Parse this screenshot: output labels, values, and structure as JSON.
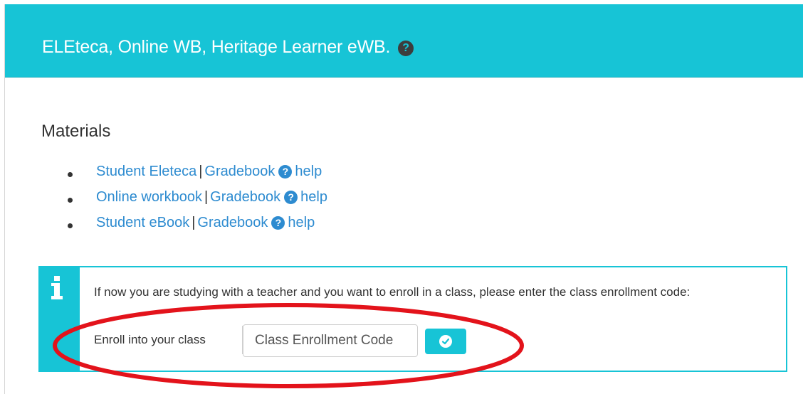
{
  "header": {
    "title": "ELEteca, Online WB, Heritage Learner eWB.",
    "help_icon": "question-circle-icon"
  },
  "materials": {
    "title": "Materials",
    "items": [
      {
        "primary": "Student Eleteca",
        "separator": "|",
        "gradebook": "Gradebook",
        "help": "help"
      },
      {
        "primary": "Online workbook",
        "separator": "|",
        "gradebook": "Gradebook",
        "help": "help"
      },
      {
        "primary": "Student eBook",
        "separator": "|",
        "gradebook": "Gradebook",
        "help": "help"
      }
    ]
  },
  "enroll_alert": {
    "icon": "info-icon",
    "message": "If now you are studying with a teacher and you want to enroll in a class, please enter the class enrollment code:",
    "label": "Enroll into your class",
    "input_placeholder": "Class Enrollment Code",
    "submit_icon": "check-circle-icon"
  },
  "colors": {
    "accent": "#17c4d6",
    "link": "#2d8bd0",
    "annotation": "#e3131b",
    "text": "#333333"
  }
}
